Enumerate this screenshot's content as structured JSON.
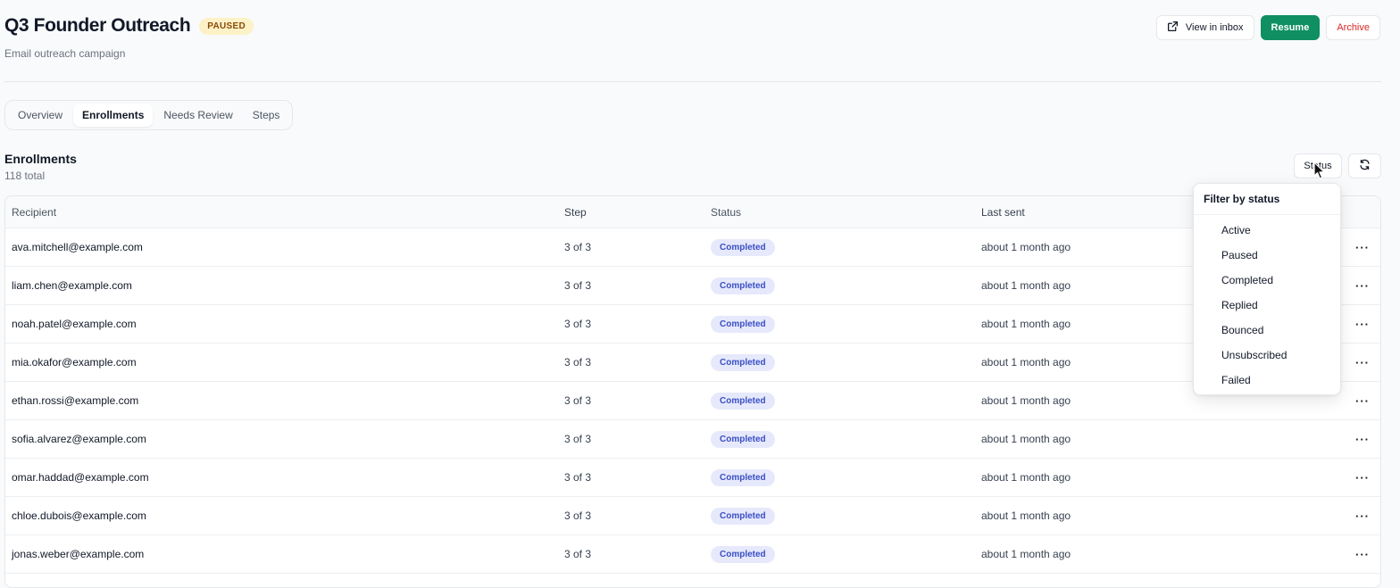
{
  "campaign": {
    "title": "Q3 Founder Outreach",
    "status_badge": "PAUSED",
    "subtitle": "Email outreach campaign"
  },
  "actions": {
    "view_inbox": "View in inbox",
    "resume": "Resume",
    "archive": "Archive"
  },
  "tabs": [
    {
      "label": "Overview",
      "active": false
    },
    {
      "label": "Enrollments",
      "active": true
    },
    {
      "label": "Needs Review",
      "active": false
    },
    {
      "label": "Steps",
      "active": false
    }
  ],
  "enrollments": {
    "title": "Enrollments",
    "count": "118 total",
    "status_filter_label": "Status",
    "columns": {
      "recipient": "Recipient",
      "step": "Step",
      "status": "Status",
      "last_sent": "Last sent"
    },
    "rows": [
      {
        "recipient": "ava.mitchell@example.com",
        "step": "3 of 3",
        "status": "Completed",
        "last_sent": "about 1 month ago"
      },
      {
        "recipient": "liam.chen@example.com",
        "step": "3 of 3",
        "status": "Completed",
        "last_sent": "about 1 month ago"
      },
      {
        "recipient": "noah.patel@example.com",
        "step": "3 of 3",
        "status": "Completed",
        "last_sent": "about 1 month ago"
      },
      {
        "recipient": "mia.okafor@example.com",
        "step": "3 of 3",
        "status": "Completed",
        "last_sent": "about 1 month ago"
      },
      {
        "recipient": "ethan.rossi@example.com",
        "step": "3 of 3",
        "status": "Completed",
        "last_sent": "about 1 month ago"
      },
      {
        "recipient": "sofia.alvarez@example.com",
        "step": "3 of 3",
        "status": "Completed",
        "last_sent": "about 1 month ago"
      },
      {
        "recipient": "omar.haddad@example.com",
        "step": "3 of 3",
        "status": "Completed",
        "last_sent": "about 1 month ago"
      },
      {
        "recipient": "chloe.dubois@example.com",
        "step": "3 of 3",
        "status": "Completed",
        "last_sent": "about 1 month ago"
      },
      {
        "recipient": "jonas.weber@example.com",
        "step": "3 of 3",
        "status": "Completed",
        "last_sent": "about 1 month ago"
      }
    ],
    "row_more_icon": "more-horizontal-icon"
  },
  "status_filter_menu": {
    "title": "Filter by status",
    "options": [
      "Active",
      "Paused",
      "Completed",
      "Replied",
      "Bounced",
      "Unsubscribed",
      "Failed"
    ]
  },
  "icons": {
    "view_inbox": "external-link-icon",
    "refresh": "refresh-icon",
    "cursor": "mouse-pointer-icon"
  },
  "colors": {
    "accent_green": "#0f8f62",
    "paused_badge_bg": "#fdf1c7",
    "paused_badge_text": "#8a4a0a",
    "archive_text": "#dc2626",
    "completed_pill_bg": "#e6e9fb",
    "completed_pill_text": "#3b4fc4"
  }
}
